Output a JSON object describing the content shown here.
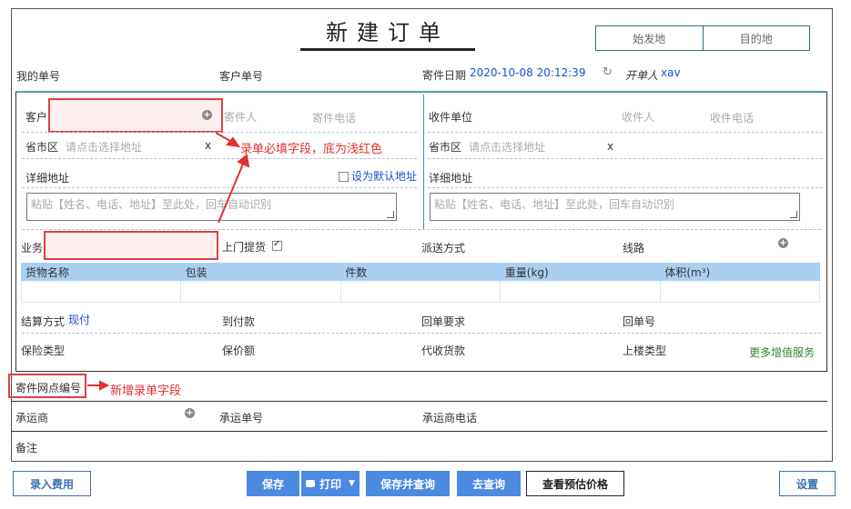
{
  "page": {
    "title": "新建订单",
    "route_tabs": [
      "始发地",
      "目的地"
    ]
  },
  "header": {
    "my_order_no": "我的单号",
    "customer_order_no": "客户单号",
    "send_date_label": "寄件日期",
    "send_date_value": "2020-10-08 20:12:39",
    "refresh_icon": "↻",
    "creator_label": "开单人",
    "creator_value": "xav"
  },
  "sender": {
    "customer_label": "客户",
    "sender_label": "寄件人",
    "sender_phone_label": "寄件电话",
    "region_label": "省市区",
    "region_placeholder": "请点击选择地址",
    "clear": "x",
    "address_label": "详细地址",
    "default_address_label": "设为默认地址",
    "paste_placeholder": "粘贴【姓名、电话、地址】至此处，回车自动识别"
  },
  "receiver": {
    "unit_label": "收件单位",
    "receiver_label": "收件人",
    "receiver_phone_label": "收件电话",
    "region_label": "省市区",
    "region_placeholder": "请点击选择地址",
    "clear": "x",
    "address_label": "详细地址",
    "paste_placeholder": "粘贴【姓名、电话、地址】至此处，回车自动识别"
  },
  "business": {
    "type_label": "业务类型",
    "pickup_label": "上门提货",
    "pickup_checked": true,
    "delivery_label": "派送方式",
    "line_label": "线路"
  },
  "goods_table": {
    "columns": [
      "货物名称",
      "包装",
      "件数",
      "重量(kg)",
      "体积(m³)"
    ]
  },
  "payment": {
    "settle_label": "结算方式",
    "settle_value": "现付",
    "cod_label": "到付款",
    "return_req_label": "回单要求",
    "return_no_label": "回单号",
    "insurance_type_label": "保险类型",
    "insured_amount_label": "保价额",
    "collect_label": "代收货款",
    "upstairs_label": "上楼类型",
    "more_services": "更多增值服务"
  },
  "extra": {
    "branch_no_label": "寄件网点编号",
    "carrier_label": "承运商",
    "carrier_no_label": "承运单号",
    "carrier_phone_label": "承运商电话",
    "remark_label": "备注"
  },
  "annotations": {
    "required_note": "录单必填字段，底为浅红色",
    "new_field_note": "新增录单字段"
  },
  "footer": {
    "enter_fee": "录入费用",
    "save": "保存",
    "print": "打印",
    "save_and_query": "保存并查询",
    "go_query": "去查询",
    "view_estimate": "查看预估价格",
    "settings": "设置"
  },
  "colors": {
    "accent_blue": "#4a8ae0",
    "header_row": "#a9cff3",
    "required_bg": "#fff0f0",
    "annotation_red": "#e03030"
  }
}
